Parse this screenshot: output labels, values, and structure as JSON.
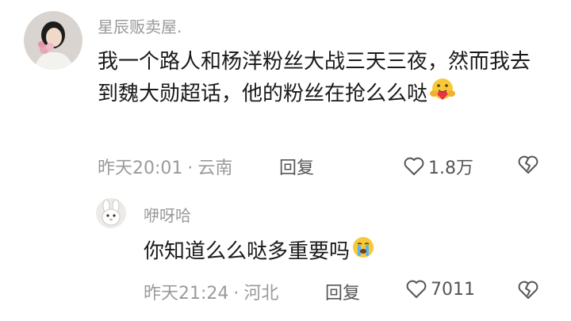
{
  "comments": [
    {
      "username": "星辰贩卖屋.",
      "text": "我一个路人和杨洋粉丝大战三天三夜，然而我去到魏大勋超话，他的粉丝在抢么么哒",
      "emoji": "hugging-face-emoji",
      "time": "昨天20:01",
      "location": "云南",
      "reply_label": "回复",
      "likes": "1.8万"
    }
  ],
  "reply": {
    "username": "咿呀哈",
    "text": "你知道么么哒多重要吗",
    "emoji": "crying-face-emoji",
    "time": "昨天21:24",
    "location": "河北",
    "reply_label": "回复",
    "likes": "7011"
  },
  "colors": {
    "meta": "#9a9a9a",
    "text": "#1a1a1a",
    "action": "#555555"
  }
}
